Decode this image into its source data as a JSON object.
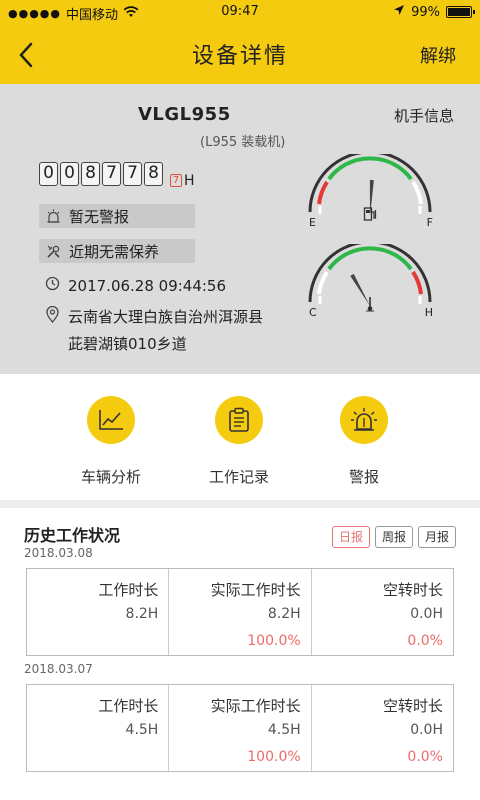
{
  "status_bar": {
    "signal": "●●●●●",
    "carrier": "中国移动",
    "time": "09:47",
    "battery": "99%"
  },
  "nav": {
    "back_icon": "chevron-left-icon",
    "title": "设备详情",
    "unbind_label": "解绑"
  },
  "device": {
    "model": "VLGL955",
    "submodel": "(L955 装载机)",
    "driver_info_label": "机手信息",
    "hours_digits": [
      "0",
      "0",
      "8",
      "7",
      "7",
      "8"
    ],
    "hours_decimal": "7",
    "hours_unit": "H",
    "alarm_status": "暂无警报",
    "maintenance_status": "近期无需保养",
    "timestamp": "2017.06.28 09:44:56",
    "address_line1": "云南省大理白族自治州洱源县",
    "address_line2": "茈碧湖镇010乡道",
    "gauges": {
      "fuel": {
        "left_label": "E",
        "right_label": "F",
        "level": 0.52,
        "icon": "fuel-pump-icon"
      },
      "temperature": {
        "left_label": "C",
        "right_label": "H",
        "level": 0.3,
        "icon": "thermometer-icon"
      }
    }
  },
  "actions": [
    {
      "label": "车辆分析",
      "icon": "line-chart-icon"
    },
    {
      "label": "工作记录",
      "icon": "clipboard-icon"
    },
    {
      "label": "警报",
      "icon": "alarm-light-icon"
    }
  ],
  "history": {
    "title": "历史工作状况",
    "tabs": [
      "日报",
      "周报",
      "月报"
    ],
    "active_tab": "日报",
    "records": [
      {
        "date": "2018.03.08",
        "columns": [
          {
            "header": "工作时长",
            "value": "8.2H",
            "percent": ""
          },
          {
            "header": "实际工作时长",
            "value": "8.2H",
            "percent": "100.0%"
          },
          {
            "header": "空转时长",
            "value": "0.0H",
            "percent": "0.0%"
          }
        ]
      },
      {
        "date": "2018.03.07",
        "columns": [
          {
            "header": "工作时长",
            "value": "4.5H",
            "percent": ""
          },
          {
            "header": "实际工作时长",
            "value": "4.5H",
            "percent": "100.0%"
          },
          {
            "header": "空转时长",
            "value": "0.0H",
            "percent": "0.0%"
          }
        ]
      }
    ]
  },
  "colors": {
    "brand_yellow": "#f5cb10",
    "panel_gray": "#dcdcdc",
    "gauge_green": "#2eb84a",
    "gauge_red": "#e53935",
    "percent_red": "#ef6a6a"
  }
}
